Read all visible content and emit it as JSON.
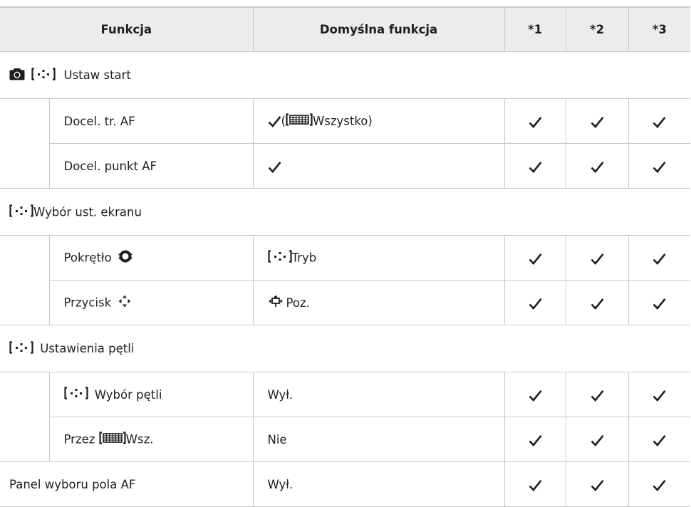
{
  "header": {
    "col_function": "Funkcja",
    "col_default": "Domyślna funkcja",
    "col_1": "*1",
    "col_2": "*2",
    "col_3": "*3"
  },
  "groups": [
    {
      "title": "Ustaw start",
      "rows": [
        {
          "function": "Docel. tr. AF",
          "default_text": "Wszystko",
          "c1": "checked",
          "c2": "checked",
          "c3": "checked"
        },
        {
          "function": "Docel. punkt AF",
          "default_text": "",
          "c1": "checked",
          "c2": "checked",
          "c3": "checked"
        }
      ]
    },
    {
      "title": "Wybór ust. ekranu",
      "rows": [
        {
          "function": "Pokrętło",
          "default_text": "Tryb",
          "c1": "checked",
          "c2": "checked",
          "c3": "checked"
        },
        {
          "function": "Przycisk",
          "default_text": "Poz.",
          "c1": "checked",
          "c2": "checked",
          "c3": "checked"
        }
      ]
    },
    {
      "title": "Ustawienia pętli",
      "rows": [
        {
          "function": "Wybór pętli",
          "default_text": "Wył.",
          "c1": "checked",
          "c2": "checked",
          "c3": "checked"
        },
        {
          "function_prefix": "Przez",
          "function": "Wsz.",
          "default_text": "Nie",
          "c1": "checked",
          "c2": "checked",
          "c3": "checked"
        }
      ]
    }
  ],
  "final_row": {
    "function": "Panel wyboru pola AF",
    "default_text": "Wył.",
    "c1": "checked",
    "c2": "checked",
    "c3": "checked"
  },
  "icons": [
    "camera-icon",
    "af-target-bracket-icon",
    "all-targets-grid-icon",
    "check-icon",
    "dial-icon",
    "arrow-pad-icon"
  ],
  "text_color": "#1f1f1f",
  "header_bg": "#ececec",
  "rule_color": "#c9c9c9"
}
